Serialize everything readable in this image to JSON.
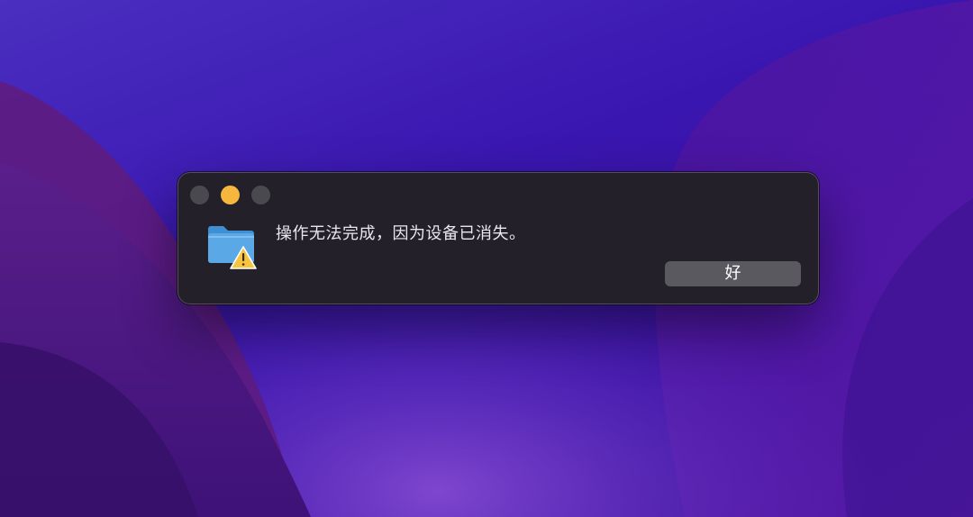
{
  "dialog": {
    "message": "操作无法完成，因为设备已消失。",
    "ok_label": "好",
    "icon": "folder-warning-icon"
  },
  "window_controls": [
    "close-button",
    "minimize-button",
    "zoom-button"
  ],
  "colors": {
    "dialog_bg": "#232029",
    "button_bg": "#5b5960",
    "minimize": "#f6b73e",
    "inactive_light": "#4b4950",
    "folder_blue": "#5aa9e6",
    "warning_yellow": "#f5c542"
  }
}
